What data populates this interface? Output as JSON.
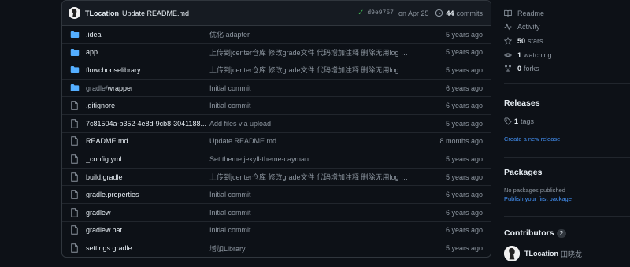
{
  "latest_commit": {
    "author": "TLocation",
    "message": "Update README.md",
    "sha": "d9e9757",
    "date": "on Apr 25",
    "commits_count": "44",
    "commits_label": "commits"
  },
  "files": [
    {
      "type": "folder",
      "name": ".idea",
      "name_prefix": "",
      "message": "优化 adapter",
      "age": "5 years ago"
    },
    {
      "type": "folder",
      "name": "app",
      "name_prefix": "",
      "message": "上传到jcenter仓库 修改grade文件 代码增加注释 删除无用log 依赖 修改...",
      "age": "5 years ago"
    },
    {
      "type": "folder",
      "name": "flowchooselibrary",
      "name_prefix": "",
      "message": "上传到jcenter仓库 修改grade文件 代码增加注释 删除无用log 依赖 修改...",
      "age": "5 years ago"
    },
    {
      "type": "folder",
      "name": "wrapper",
      "name_prefix": "gradle/",
      "message": "Initial commit",
      "age": "6 years ago"
    },
    {
      "type": "file",
      "name": ".gitignore",
      "name_prefix": "",
      "message": "Initial commit",
      "age": "6 years ago"
    },
    {
      "type": "file",
      "name": "7c81504a-b352-4e8d-9cb8-3041188...",
      "name_prefix": "",
      "message": "Add files via upload",
      "age": "5 years ago"
    },
    {
      "type": "file",
      "name": "README.md",
      "name_prefix": "",
      "message": "Update README.md",
      "age": "8 months ago"
    },
    {
      "type": "file",
      "name": "_config.yml",
      "name_prefix": "",
      "message": "Set theme jekyll-theme-cayman",
      "age": "5 years ago"
    },
    {
      "type": "file",
      "name": "build.gradle",
      "name_prefix": "",
      "message": "上传到jcenter仓库 修改grade文件 代码增加注释 删除无用log 依赖 修改...",
      "age": "5 years ago"
    },
    {
      "type": "file",
      "name": "gradle.properties",
      "name_prefix": "",
      "message": "Initial commit",
      "age": "6 years ago"
    },
    {
      "type": "file",
      "name": "gradlew",
      "name_prefix": "",
      "message": "Initial commit",
      "age": "6 years ago"
    },
    {
      "type": "file",
      "name": "gradlew.bat",
      "name_prefix": "",
      "message": "Initial commit",
      "age": "6 years ago"
    },
    {
      "type": "file",
      "name": "settings.gradle",
      "name_prefix": "",
      "message": "增加Library",
      "age": "5 years ago"
    }
  ],
  "sidebar": {
    "readme": "Readme",
    "activity": "Activity",
    "stars_count": "50",
    "stars_label": "stars",
    "watching_count": "1",
    "watching_label": "watching",
    "forks_count": "0",
    "forks_label": "forks",
    "releases_title": "Releases",
    "tags_count": "1",
    "tags_label": "tags",
    "create_release": "Create a new release",
    "packages_title": "Packages",
    "packages_empty": "No packages published",
    "publish_package": "Publish your first package",
    "contributors_title": "Contributors",
    "contributors_count": "2",
    "contributor_name": "TLocation",
    "contributor_fullname": "田晓龙"
  },
  "colors": {
    "folder": "#54aeff",
    "accent": "#4493f8",
    "success": "#3fb950"
  }
}
